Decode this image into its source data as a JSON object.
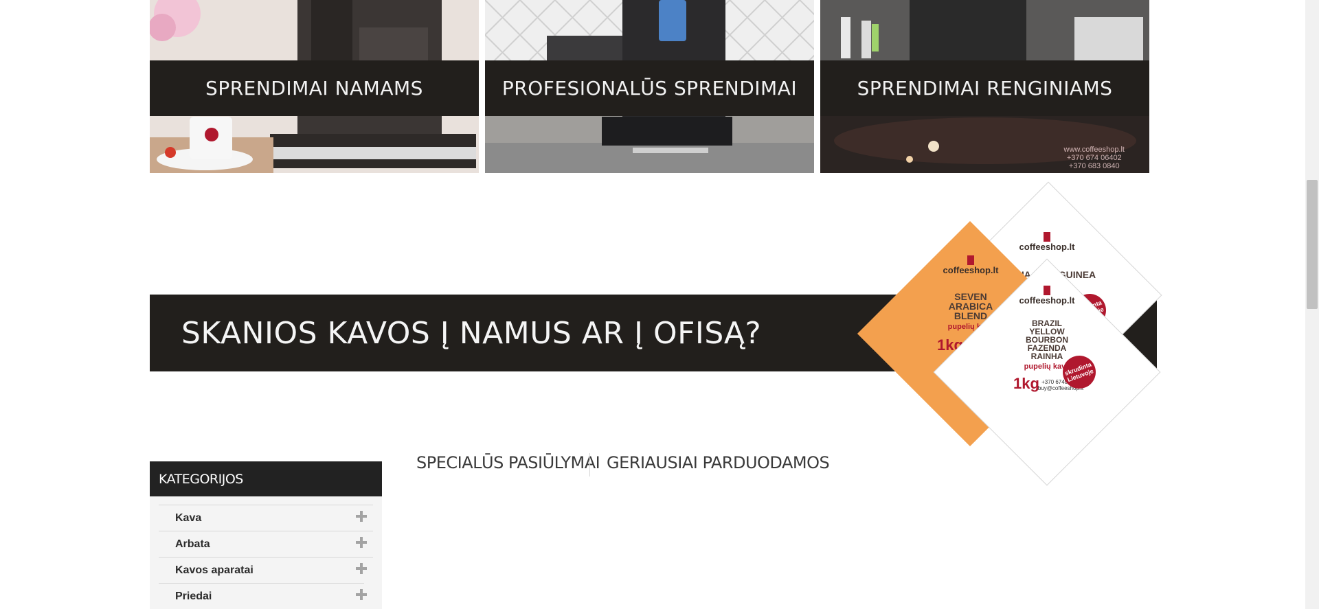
{
  "tiles": [
    {
      "label": "SPRENDIMAI NAMAMS"
    },
    {
      "label": "PROFESIONALŪS SPRENDIMAI"
    },
    {
      "label": "SPRENDIMAI RENGINIAMS",
      "photo_text": [
        "www.coffeeshop.lt",
        "+370 674 06402",
        "+370 683 0840"
      ]
    }
  ],
  "banner": {
    "text": "SKANIOS KAVOS Į NAMUS AR Į OFISĄ?",
    "bags": [
      {
        "brand": "coffeeshop.lt",
        "name": "SEVEN ARABICA BLEND",
        "sub": "pupelių kava",
        "weight": "1kg",
        "color": "#f3a04e"
      },
      {
        "brand": "coffeeshop.lt",
        "name": "PAPUA NEW GUINEA",
        "stamp": "skrudinta Lietuvoje",
        "color": "#ffffff"
      },
      {
        "brand": "coffeeshop.lt",
        "name": "BRAZIL YELLOW BOURBON FAZENDA RAINHA",
        "sub": "pupelių kava",
        "weight": "1kg",
        "stamp": "skrudinta Lietuvoje",
        "phone": "+370 67406402",
        "email": "buy@coffeeshop.lt",
        "color": "#ffffff"
      }
    ]
  },
  "sidebar": {
    "title": "KATEGORIJOS",
    "items": [
      {
        "label": "Kava"
      },
      {
        "label": "Arbata"
      },
      {
        "label": "Kavos aparatai"
      },
      {
        "label": "Priedai"
      }
    ]
  },
  "tabs": [
    {
      "label": "SPECIALŪS PASIŪLYMAI"
    },
    {
      "label": "GERIAUSIAI PARDUODAMOS"
    }
  ],
  "colors": {
    "dark_band": "#221f1c",
    "accent_red": "#b0182e",
    "orange": "#f3a04e",
    "sidebar_bg": "#f4f4f4"
  }
}
